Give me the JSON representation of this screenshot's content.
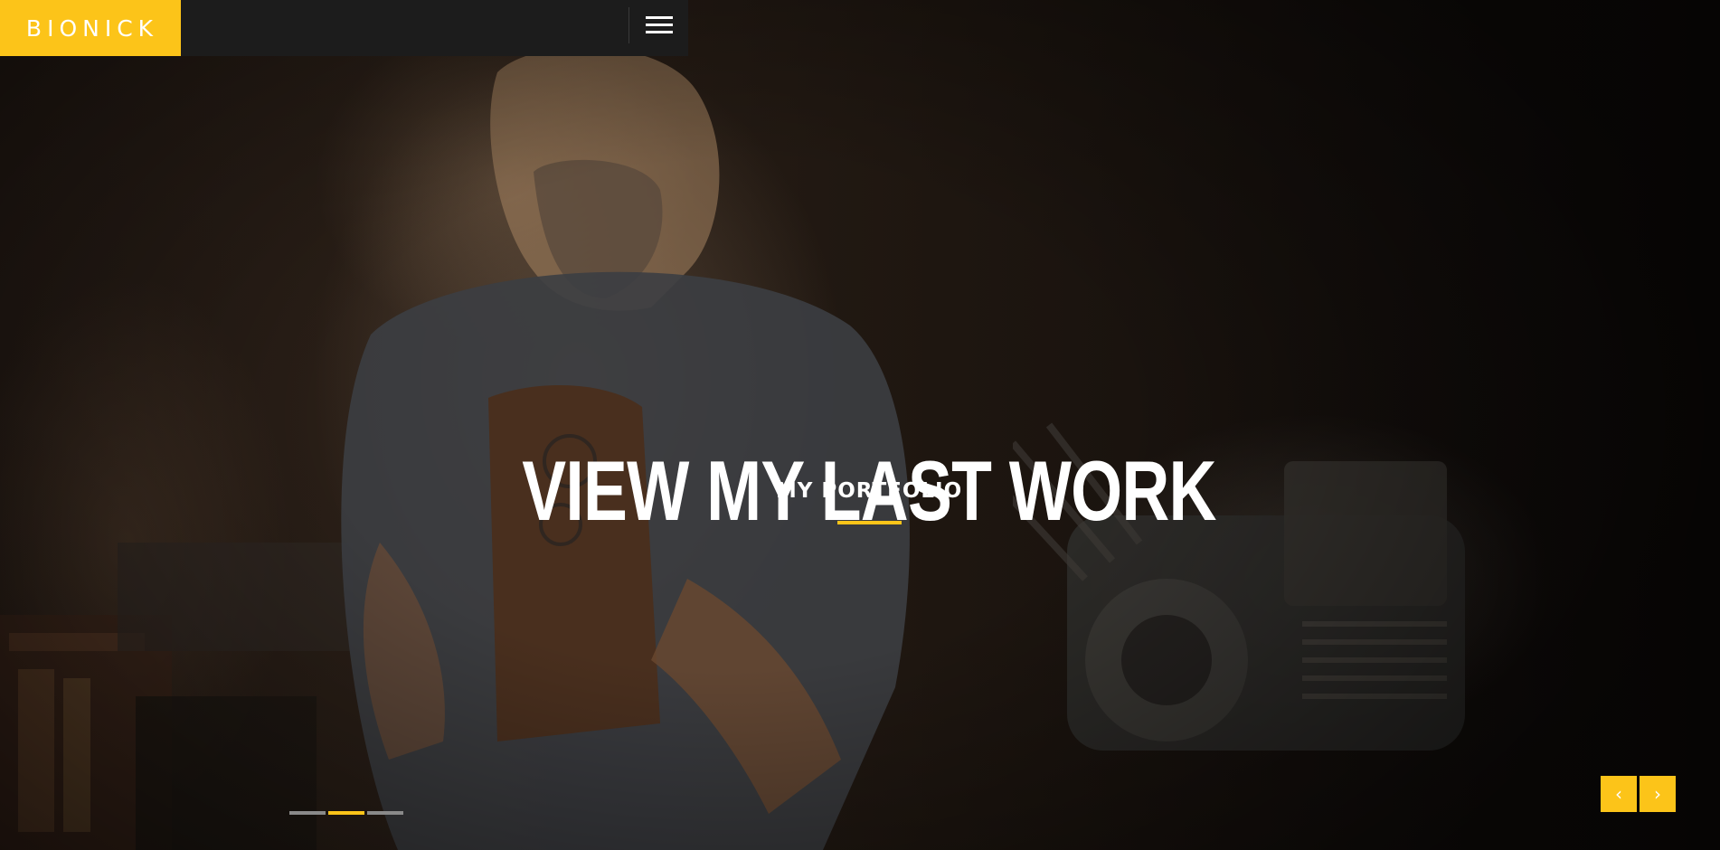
{
  "header": {
    "logo_text": "BIONICK",
    "menu_icon": "hamburger-menu-icon"
  },
  "hero": {
    "title": "VIEW MY LAST WORK",
    "subtitle": "MY PORTFOLIO"
  },
  "slider": {
    "slide_count": 3,
    "active_slide": 2,
    "prev_icon": "chevron-left-icon",
    "next_icon": "chevron-right-icon",
    "prev_glyph": "‹",
    "next_glyph": "›"
  },
  "colors": {
    "accent": "#fcc419",
    "header_bg": "#1c1c1c",
    "text": "#ffffff",
    "inactive_dot": "#8a8a8a"
  }
}
